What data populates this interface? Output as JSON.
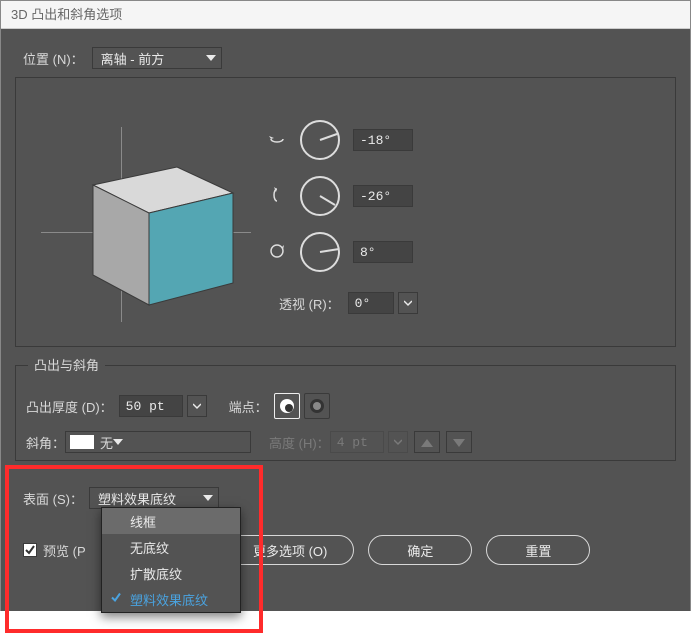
{
  "window": {
    "title": "3D 凸出和斜角选项"
  },
  "position": {
    "label": "位置 (N)：",
    "value": "离轴 - 前方"
  },
  "angles": {
    "x": {
      "label_icon": "rotate-x",
      "value": "-18°"
    },
    "y": {
      "label_icon": "rotate-y",
      "value": "-26°"
    },
    "z": {
      "label_icon": "rotate-z",
      "value": "8°"
    }
  },
  "perspective": {
    "label": "透视 (R)：",
    "value": "0°"
  },
  "extrude_group": {
    "title": "凸出与斜角",
    "depth_label": "凸出厚度 (D)：",
    "depth_value": "50 pt",
    "cap_label": "端点：",
    "bevel_label": "斜角：",
    "bevel_value": "无",
    "height_label": "高度 (H)：",
    "height_value": "4 pt"
  },
  "surface": {
    "label": "表面 (S)：",
    "value": "塑料效果底纹",
    "options": [
      {
        "label": "线框",
        "selected": false
      },
      {
        "label": "无底纹",
        "selected": false
      },
      {
        "label": "扩散底纹",
        "selected": false
      },
      {
        "label": "塑料效果底纹",
        "selected": true
      }
    ]
  },
  "preview": {
    "label": "预览 (P",
    "checked": true,
    "closing": ")"
  },
  "buttons": {
    "more": "更多选项 (O)",
    "ok": "确定",
    "reset": "重置"
  }
}
